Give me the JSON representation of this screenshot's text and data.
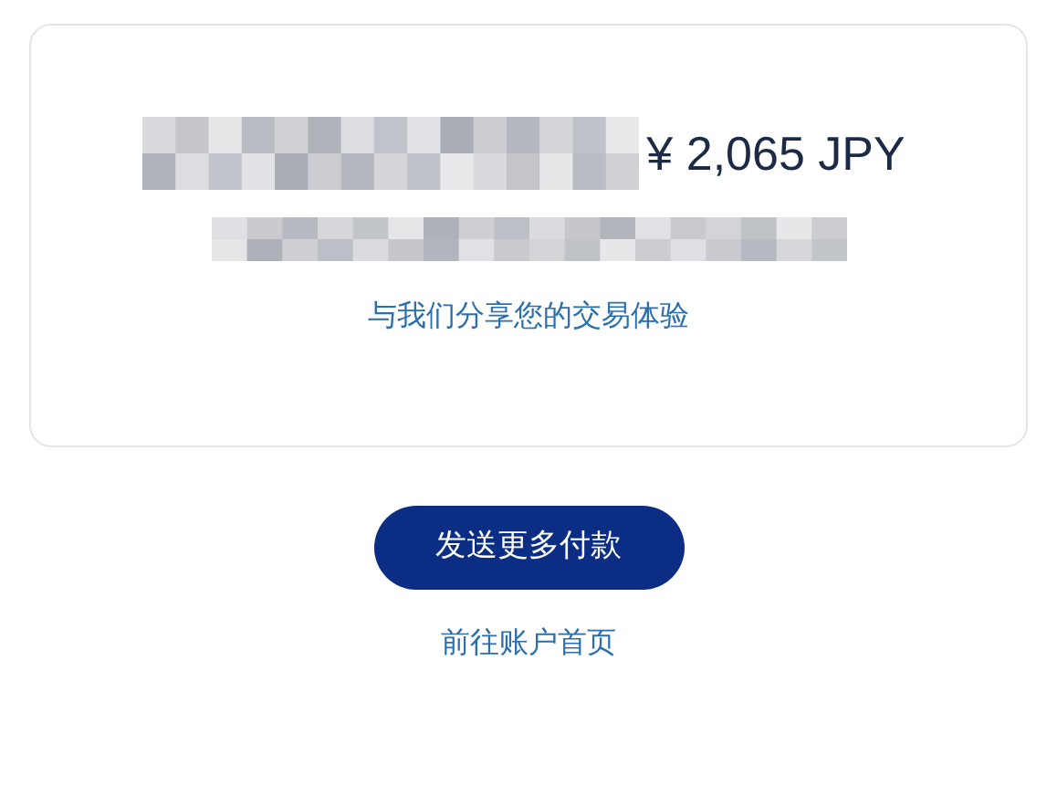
{
  "card": {
    "heading": {
      "redacted": true,
      "amount": "¥ 2,065 JPY"
    },
    "message": {
      "redacted": true
    },
    "feedback_link": "与我们分享您的交易体验"
  },
  "primary_button": "发送更多付款",
  "account_link": "前往账户首页"
}
